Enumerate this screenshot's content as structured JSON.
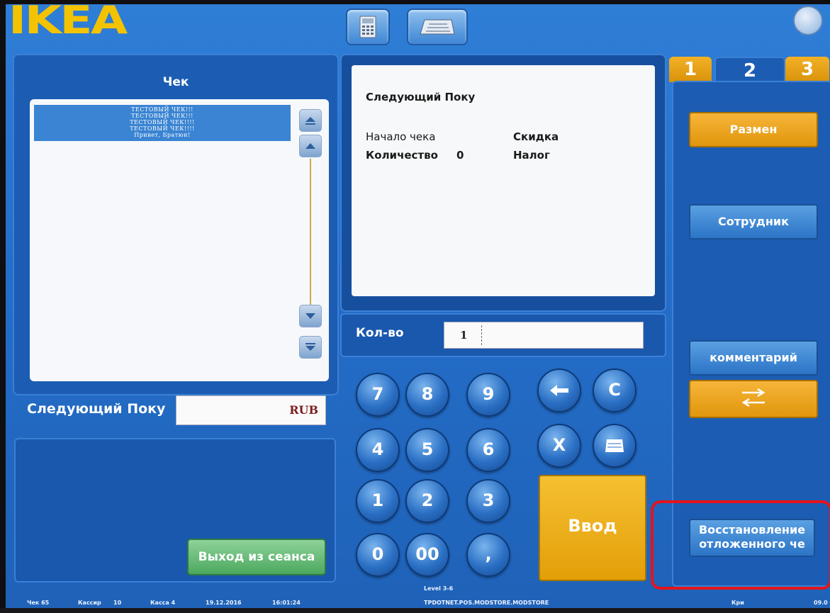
{
  "header": {
    "logo_text": "IKEA",
    "calculator_icon": "calculator-icon",
    "drawer_icon": "cash-drawer-icon"
  },
  "receipt_panel": {
    "title": "Чек",
    "lines": [
      "ТЕСТОВЫЙ ЧЕК!!!",
      "ТЕСТОВЫЙ ЧЕК!!!",
      "ТЕСТОВЫЙ ЧЕК!!!!",
      "ТЕСТОВЫЙ ЧЕК!!!!",
      "Привет, Братюн!"
    ]
  },
  "next_customer": {
    "label": "Следующий Поку",
    "currency": "RUB"
  },
  "logout_button": "Выход из сеанса",
  "display": {
    "title": "Следующий Поку",
    "start_label": "Начало чека",
    "discount_label": "Скидка",
    "quantity_label": "Количество",
    "quantity_value": "0",
    "tax_label": "Налог"
  },
  "quantity": {
    "label": "Кол-во",
    "value": "1"
  },
  "keypad": {
    "k7": "7",
    "k8": "8",
    "k9": "9",
    "k4": "4",
    "k5": "5",
    "k6": "6",
    "k1": "1",
    "k2": "2",
    "k3": "3",
    "k0": "0",
    "k00": "00",
    "comma": ",",
    "clear": "C",
    "multiply": "X",
    "enter": "Ввод"
  },
  "tabs": [
    "1",
    "2",
    "3"
  ],
  "active_tab": "2",
  "right_buttons": {
    "change": "Размен",
    "employee": "Сотрудник",
    "comment": "комментарий",
    "restore_line1": "Восстановление",
    "restore_line2": "отложенного че"
  },
  "status_bar": {
    "receipt": "Чек 65",
    "cashier_label": "Кассир",
    "cashier_value": "10",
    "register": "Касса 4",
    "date": "19.12.2016",
    "time": "16:01:24",
    "level": "Level 3-6",
    "host": "TPDOTNET.POS.MODSTORE.MODSTORE",
    "kpu": "Кри",
    "right_value": "09.0"
  }
}
